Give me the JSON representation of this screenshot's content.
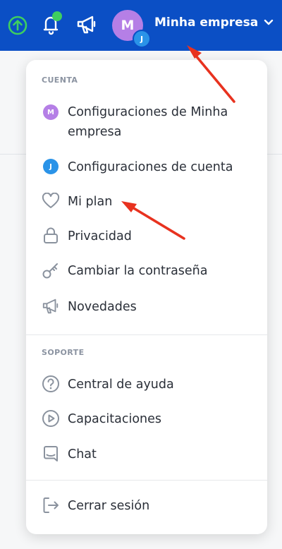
{
  "header": {
    "company_name": "Minha empresa",
    "avatar_initial": "M",
    "avatar_sub_initial": "J",
    "avatar_color": "#b57fe6",
    "sub_color": "#2a93e8",
    "bar_color": "#0b4fc5",
    "icons": [
      "arrow-up-circle-icon",
      "bell-icon",
      "megaphone-icon",
      "chevron-down-icon"
    ]
  },
  "menu": {
    "account_title": "CUENTA",
    "account_items": [
      {
        "label": "Configuraciones de Minha empresa",
        "icon": "avatar-M"
      },
      {
        "label": "Configuraciones de cuenta",
        "icon": "avatar-J"
      },
      {
        "label": "Mi plan",
        "icon": "heart-icon"
      },
      {
        "label": "Privacidad",
        "icon": "lock-icon"
      },
      {
        "label": "Cambiar la contraseña",
        "icon": "key-icon"
      },
      {
        "label": "Novedades",
        "icon": "megaphone-icon"
      }
    ],
    "support_title": "SOPORTE",
    "support_items": [
      {
        "label": "Central de ayuda",
        "icon": "help-circle-icon"
      },
      {
        "label": "Capacitaciones",
        "icon": "play-circle-icon"
      },
      {
        "label": "Chat",
        "icon": "chat-icon"
      }
    ],
    "logout_label": "Cerrar sesión"
  }
}
